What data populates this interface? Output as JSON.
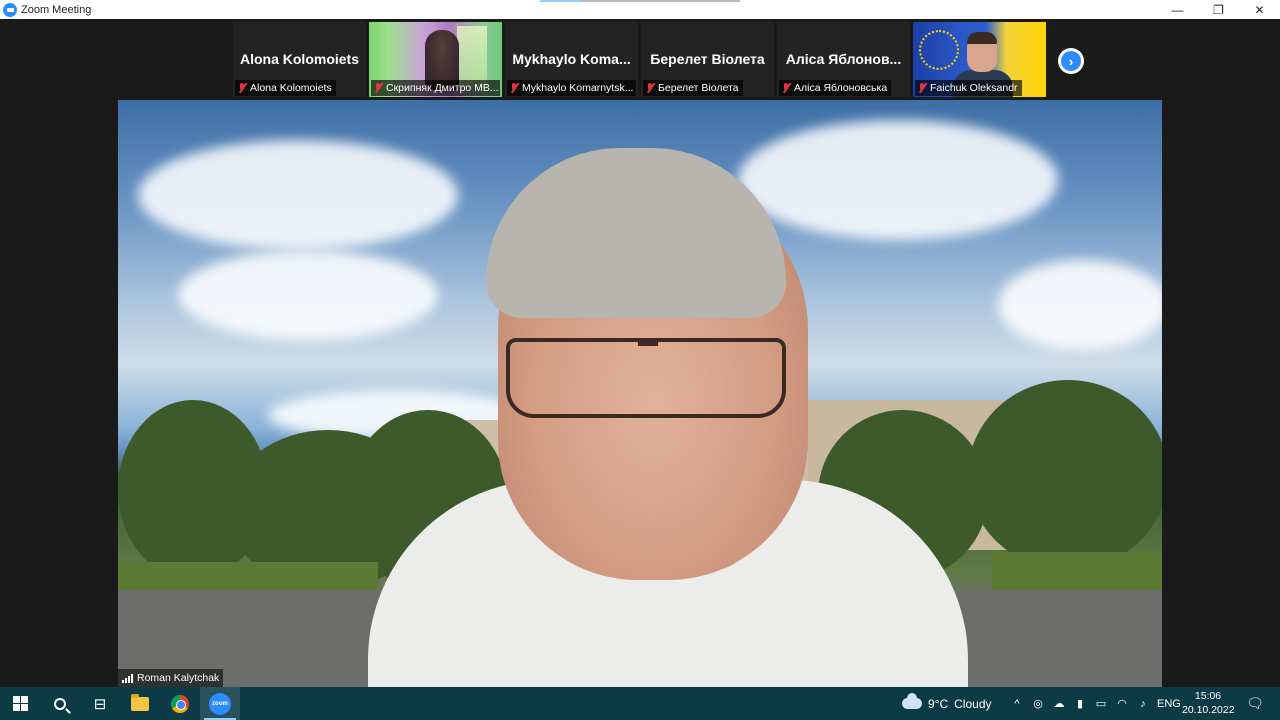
{
  "window": {
    "title": "Zoom Meeting",
    "controls": {
      "minimize": "—",
      "maximize": "❐",
      "close": "✕"
    }
  },
  "gallery": {
    "tiles": [
      {
        "big_name": "Alona Kolomoiets",
        "label": "Alona Kolomoiets",
        "video": false,
        "mic": "muted"
      },
      {
        "big_name": "",
        "label": "Скрипняк Дмитро МВ...",
        "video": true,
        "mic": "muted"
      },
      {
        "big_name": "Mykhaylo  Koma...",
        "label": "Mykhaylo Komarnytsk...",
        "video": false,
        "mic": "muted"
      },
      {
        "big_name": "Берелет Віолета",
        "label": "Берелет Віолета",
        "video": false,
        "mic": "muted"
      },
      {
        "big_name": "Аліса Яблонов...",
        "label": "Аліса Яблоновська",
        "video": false,
        "mic": "muted"
      },
      {
        "big_name": "",
        "label": "Faichuk Oleksandr",
        "video": true,
        "mic": "muted"
      }
    ],
    "next_button": "›"
  },
  "main_speaker": {
    "name": "Roman Kalytchak"
  },
  "taskbar": {
    "zoom_icon_text": "zoom",
    "weather": {
      "temperature": "9°C",
      "condition": "Cloudy"
    },
    "tray": {
      "chevron": "^",
      "language": "ENG"
    },
    "clock": {
      "time": "15:06",
      "date": "20.10.2022"
    }
  }
}
